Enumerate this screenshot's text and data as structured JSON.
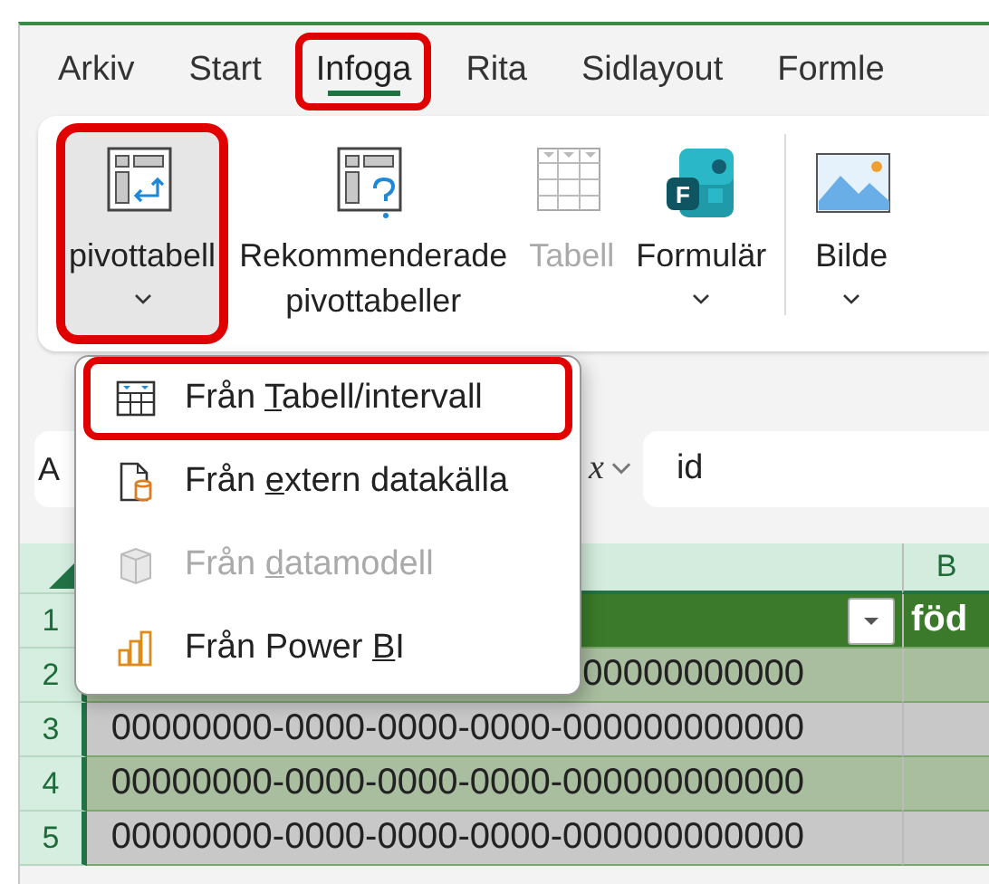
{
  "tabs": [
    {
      "label": "Arkiv",
      "selected": false,
      "highlighted": false
    },
    {
      "label": "Start",
      "selected": false,
      "highlighted": false
    },
    {
      "label": "Infoga",
      "selected": true,
      "highlighted": true
    },
    {
      "label": "Rita",
      "selected": false,
      "highlighted": false
    },
    {
      "label": "Sidlayout",
      "selected": false,
      "highlighted": false
    },
    {
      "label": "Formle",
      "selected": false,
      "highlighted": false
    }
  ],
  "ribbon": {
    "buttons": [
      {
        "kind": "pivot",
        "lines": [
          "pivottabell"
        ],
        "dropdown": true,
        "pressed": true,
        "highlighted": true,
        "disabled": false
      },
      {
        "kind": "recommended",
        "lines": [
          "Rekommenderade",
          "pivottabeller"
        ],
        "dropdown": false,
        "pressed": false,
        "highlighted": false,
        "disabled": false
      },
      {
        "kind": "table",
        "lines": [
          "Tabell"
        ],
        "dropdown": false,
        "pressed": false,
        "highlighted": false,
        "disabled": true
      },
      {
        "kind": "forms",
        "icon_text": "F",
        "lines": [
          "Formulär"
        ],
        "dropdown": true,
        "pressed": false,
        "highlighted": false,
        "disabled": false
      },
      {
        "kind": "picture",
        "lines": [
          "Bilde"
        ],
        "dropdown": true,
        "pressed": false,
        "highlighted": false,
        "disabled": false
      }
    ]
  },
  "menu": {
    "items": [
      {
        "kind": "table",
        "before": "Från ",
        "key": "T",
        "after": "abell/intervall",
        "disabled": false,
        "highlighted": true
      },
      {
        "kind": "external",
        "before": "Från ",
        "key": "e",
        "after": "xtern datakälla",
        "disabled": false,
        "highlighted": false
      },
      {
        "kind": "datamodel",
        "before": "Från ",
        "key": "d",
        "after": "atamodell",
        "disabled": true,
        "highlighted": false
      },
      {
        "kind": "powerbi",
        "before": "Från Power ",
        "key": "B",
        "after": "I",
        "disabled": false,
        "highlighted": false
      }
    ]
  },
  "formula_bar": {
    "name_box": "A",
    "function_label": "x",
    "value": "id"
  },
  "grid": {
    "column_b": "B",
    "rows": [
      {
        "number": "1",
        "kind": "header",
        "column_b": "föd"
      },
      {
        "number": "2",
        "kind": "data",
        "column_a": "00000000000"
      },
      {
        "number": "3",
        "kind": "data",
        "column_a": "00000000-0000-0000-0000-000000000000"
      },
      {
        "number": "4",
        "kind": "data",
        "column_a": "00000000-0000-0000-0000-000000000000"
      },
      {
        "number": "5",
        "kind": "data",
        "column_a": "00000000-0000-0000-0000-000000000000"
      }
    ]
  }
}
